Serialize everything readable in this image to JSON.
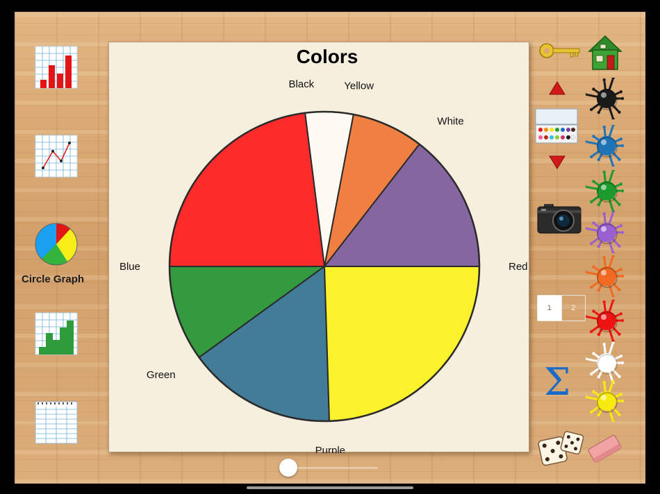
{
  "sidebar": {
    "active_label": "Circle Graph"
  },
  "chart_data": {
    "type": "pie",
    "title": "Colors",
    "slices": [
      {
        "label": "Red",
        "value": 14.5,
        "color": "#8666a0"
      },
      {
        "label": "White",
        "value": 7.5,
        "color": "#f08041"
      },
      {
        "label": "Yellow",
        "value": 5,
        "color": "#fefaf1"
      },
      {
        "label": "Black",
        "value": 23,
        "color": "#fe2b2b"
      },
      {
        "label": "Blue",
        "value": 10,
        "color": "#339a3f"
      },
      {
        "label": "Green",
        "value": 15.5,
        "color": "#437c98"
      },
      {
        "label": "Purple",
        "value": 24.5,
        "color": "#fbf22b"
      }
    ]
  },
  "page_toggle": {
    "page1": "1",
    "page2": "2"
  },
  "colors": {
    "paint_black": "#1a1a1a",
    "paint_blue": "#1f74b8",
    "paint_green": "#1c9a2c",
    "paint_purple": "#9a60d0",
    "paint_orange": "#f06a22",
    "paint_red": "#ee1414",
    "paint_white": "#ffffff",
    "paint_yellow": "#f6ea10"
  },
  "icons": {
    "sum": "Σ"
  }
}
